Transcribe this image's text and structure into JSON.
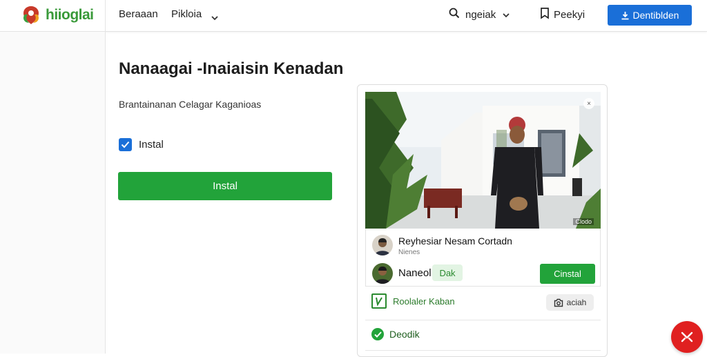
{
  "header": {
    "logo_text": "hiioglai",
    "nav_items": [
      "Beraaan",
      "Pikloia"
    ],
    "search_label": "ngeiak",
    "pricing_label": "Peekyi",
    "cta_label": "Dentiblden"
  },
  "main": {
    "title": "Nanaagai -Inaiaisin Kenadan",
    "subtitle": "Brantainanan Celagar Kaganioas",
    "checkbox_label": "Instal",
    "checkbox_checked": true,
    "install_button": "Instal"
  },
  "card": {
    "photo_tag": "Clodo",
    "publisher_name": "Reyhesiar Nesam Cortadn",
    "publisher_meta": "Nienes",
    "author_name": "Naneol",
    "badge": "Dak",
    "install_button": "Cinstal",
    "row1_label": "Roolaler Kaban",
    "chip_label": "aciah",
    "row2_label": "Deodik"
  },
  "colors": {
    "primary_blue": "#1a6fd8",
    "install_green": "#22a33a",
    "logo_green": "#3a9a3a",
    "fab_red": "#e02020"
  }
}
